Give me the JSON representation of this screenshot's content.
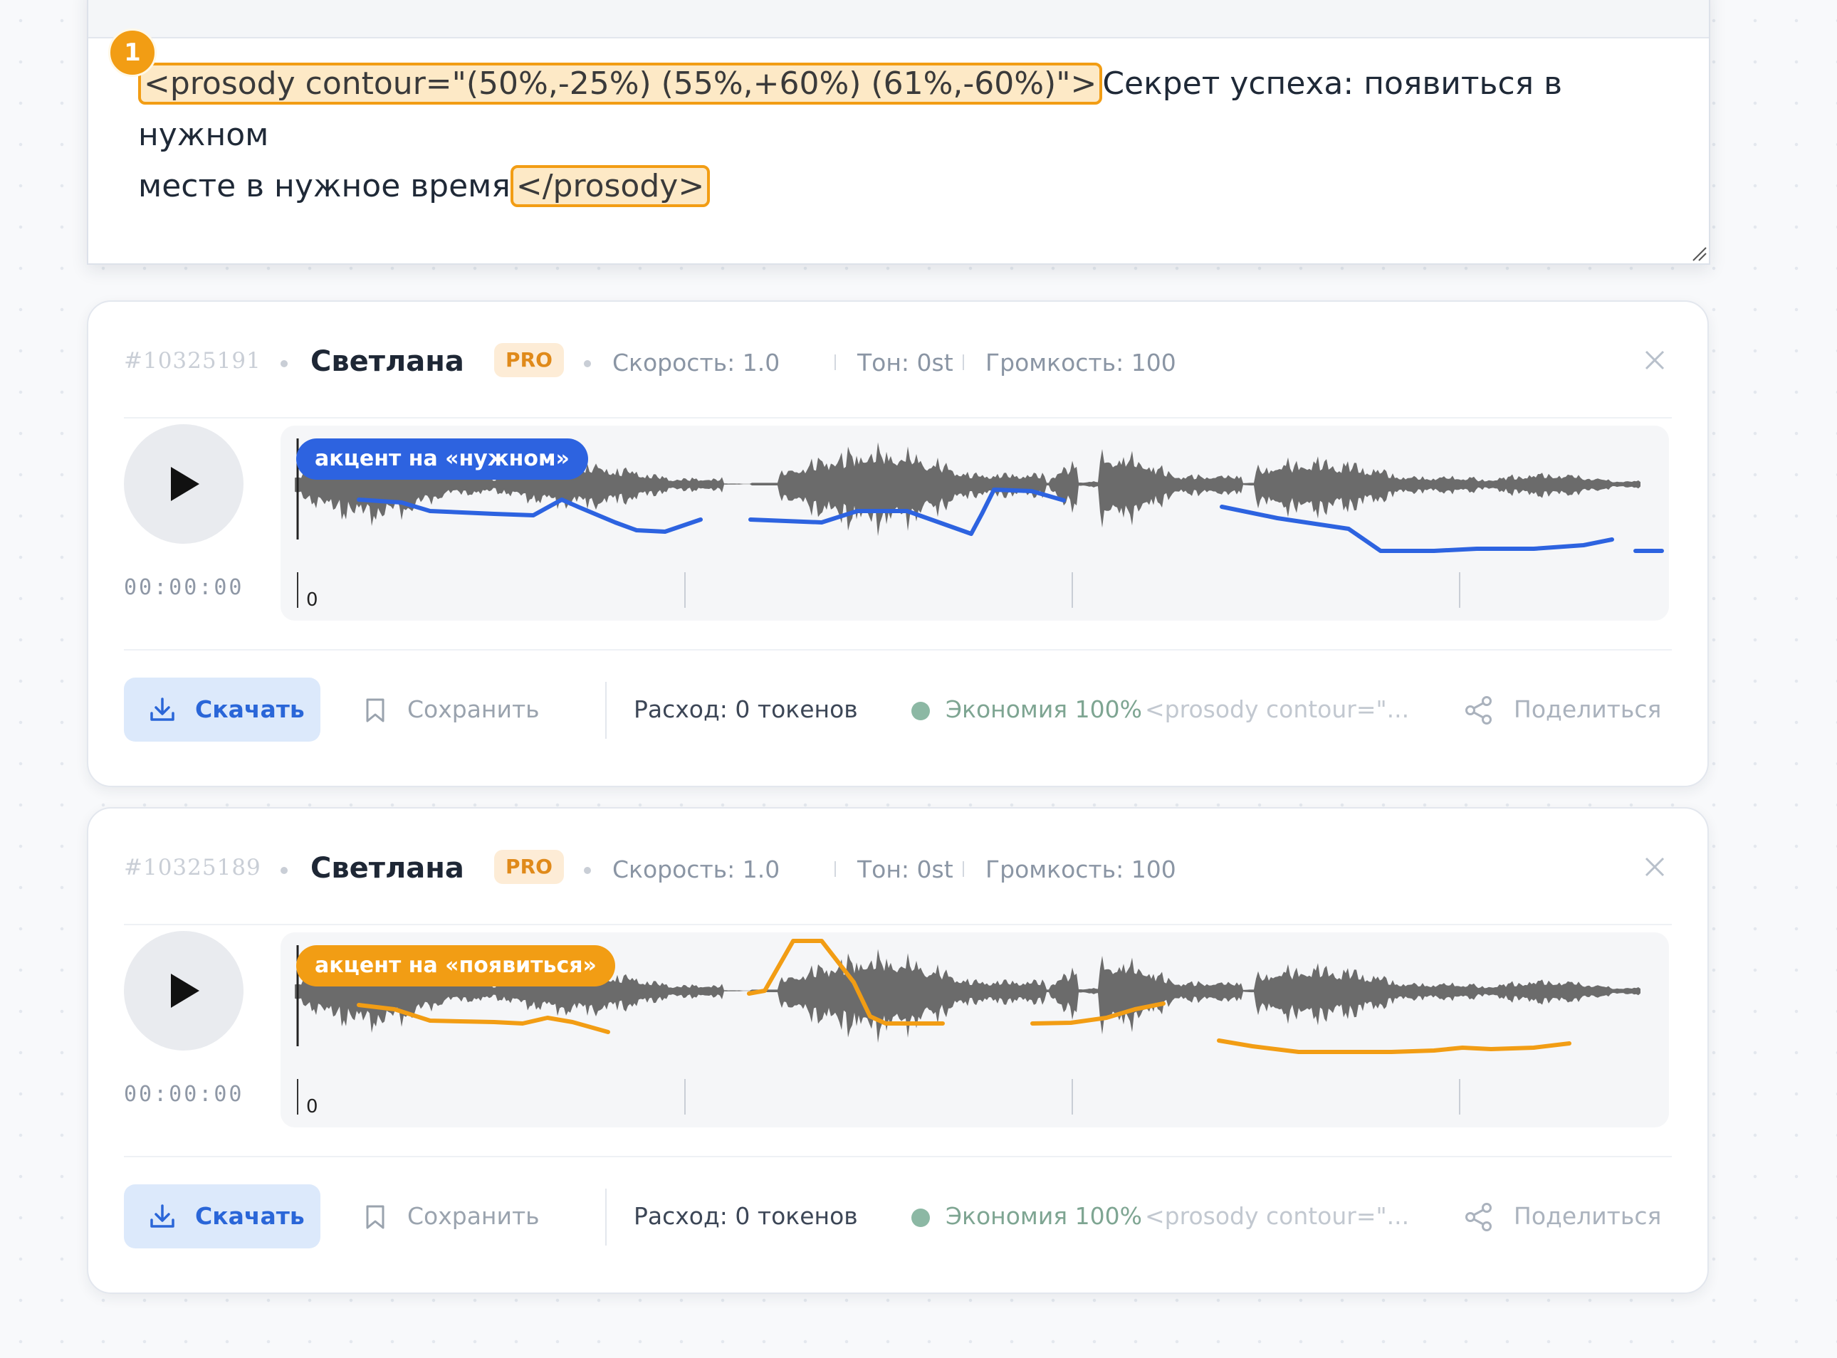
{
  "editor": {
    "marker": "1",
    "open_tag": "<prosody contour=\"(50%,-25%) (55%,+60%) (61%,-60%)\">",
    "text_part1": "Секрет успеха: появиться в нужном",
    "text_part2": "месте в нужное время",
    "close_tag": "</prosody>"
  },
  "cards": [
    {
      "id": "#10325191",
      "voice": "Светлана",
      "badge": "PRO",
      "speed": "Скорость: 1.0",
      "tone": "Тон: 0st",
      "volume": "Громкость: 100",
      "time": "00:00:00",
      "pill": "акцент на «нужном»",
      "pill_color": "#2d63e0",
      "curve_color": "#2d63e0",
      "axis_zero": "0",
      "download": "Скачать",
      "save": "Сохранить",
      "cost": "Расход: 0 токенов",
      "economy": "Экономия 100%",
      "snippet": "<prosody contour=\"...",
      "share": "Поделиться"
    },
    {
      "id": "#10325189",
      "voice": "Светлана",
      "badge": "PRO",
      "speed": "Скорость: 1.0",
      "tone": "Тон: 0st",
      "volume": "Громкость: 100",
      "time": "00:00:00",
      "pill": "акцент на «появиться»",
      "pill_color": "#f29d14",
      "curve_color": "#f29d14",
      "axis_zero": "0",
      "download": "Скачать",
      "save": "Сохранить",
      "cost": "Расход: 0 токенов",
      "economy": "Экономия 100%",
      "snippet": "<prosody contour=\"...",
      "share": "Поделиться"
    }
  ],
  "colors": {
    "accent_blue": "#2d63e0",
    "accent_orange": "#f29d14",
    "waveform": "#6b6b6b",
    "economy_dot": "#8cb8a4"
  },
  "icons": [
    "play-icon",
    "close-icon",
    "download-icon",
    "bookmark-icon",
    "share-icon",
    "resize-grip-icon"
  ]
}
